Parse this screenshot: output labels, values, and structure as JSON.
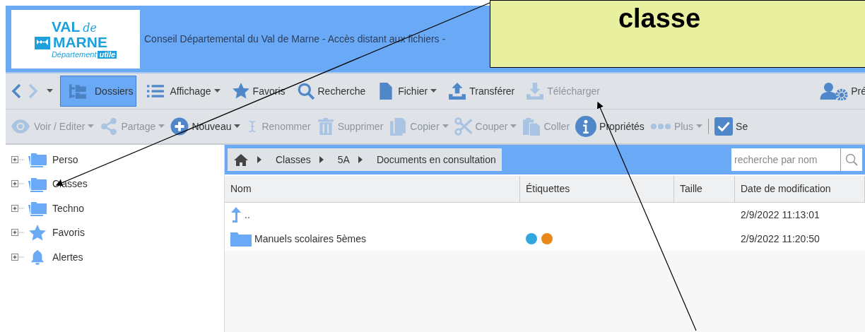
{
  "logo": {
    "line1": "VAL",
    "line1_script": "de",
    "line2": "MARNE",
    "tagline": "Département",
    "tag": "utile"
  },
  "banner": {
    "title": "Conseil Départemental du Val de Marne - Accès distant aux fichiers -"
  },
  "callout": {
    "text": "classe"
  },
  "toolbar": [
    {
      "kind": "back",
      "disabled": false
    },
    {
      "kind": "forward",
      "disabled": true
    },
    {
      "kind": "history",
      "disabled": false
    },
    {
      "label": "Dossiers",
      "kind": "folders",
      "selected": true,
      "disabled": false,
      "menu": false
    },
    {
      "label": "Affichage",
      "kind": "list",
      "selected": false,
      "disabled": false,
      "menu": true
    },
    {
      "label": "Favoris",
      "kind": "star",
      "selected": false,
      "disabled": false,
      "menu": false
    },
    {
      "label": "Recherche",
      "kind": "search",
      "selected": false,
      "disabled": false,
      "menu": false
    },
    {
      "label": "Fichier",
      "kind": "file",
      "selected": false,
      "disabled": false,
      "menu": true
    },
    {
      "label": "Transférer",
      "kind": "upload",
      "selected": false,
      "disabled": false,
      "menu": false
    },
    {
      "label": "Télécharger",
      "kind": "download",
      "selected": false,
      "disabled": true,
      "menu": false
    }
  ],
  "toolbar_right": {
    "label": "Pré"
  },
  "actions": [
    {
      "label": "Voir / Editer",
      "kind": "eye",
      "disabled": true,
      "menu": true
    },
    {
      "label": "Partage",
      "kind": "share",
      "disabled": true,
      "menu": true
    },
    {
      "label": "Nouveau",
      "kind": "plus",
      "disabled": false,
      "menu": true
    },
    {
      "label": "Renommer",
      "kind": "cursor",
      "disabled": true,
      "menu": false
    },
    {
      "label": "Supprimer",
      "kind": "trash",
      "disabled": true,
      "menu": false
    },
    {
      "label": "Copier",
      "kind": "copy",
      "disabled": true,
      "menu": true
    },
    {
      "label": "Couper",
      "kind": "scissors",
      "disabled": true,
      "menu": true
    },
    {
      "label": "Coller",
      "kind": "paste",
      "disabled": true,
      "menu": false
    },
    {
      "label": "Propriétés",
      "kind": "info",
      "disabled": false,
      "menu": false
    },
    {
      "label": "Plus",
      "kind": "dots",
      "disabled": true,
      "menu": true
    },
    {
      "label": "Se",
      "kind": "check",
      "disabled": false,
      "menu": false,
      "separator": true
    }
  ],
  "tree": [
    {
      "label": "Perso",
      "kind": "folder"
    },
    {
      "label": "Classes",
      "kind": "folder"
    },
    {
      "label": "Techno",
      "kind": "folder"
    },
    {
      "label": "Favoris",
      "kind": "star"
    },
    {
      "label": "Alertes",
      "kind": "bell"
    }
  ],
  "breadcrumb": [
    "Classes",
    "5A",
    "Documents en consultation"
  ],
  "search": {
    "placeholder": "recherche par nom"
  },
  "table": {
    "columns": [
      "Nom",
      "Étiquettes",
      "Taille",
      "Date de modification"
    ],
    "rows": [
      {
        "kind": "parent",
        "name": "..",
        "tags": [],
        "date": "2/9/2022 11:13:01"
      },
      {
        "kind": "folder",
        "name": "Manuels scolaires 5èmes",
        "tags": [
          {
            "color": "#33a7e0"
          },
          {
            "color": "#e8891a"
          }
        ],
        "date": "2/9/2022 11:20:50"
      }
    ]
  }
}
